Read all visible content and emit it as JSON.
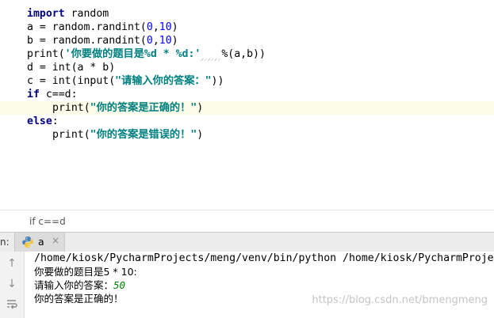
{
  "editor": {
    "lines": {
      "l1_kw": "import",
      "l1_rest": " random",
      "l2_a": "a = random.randint(",
      "l2_n1": "0",
      "l2_c": ",",
      "l2_n2": "10",
      "l2_e": ")",
      "l3_a": "b = random.randint(",
      "l3_n1": "0",
      "l3_c": ",",
      "l3_n2": "10",
      "l3_e": ")",
      "l4_a": "print(",
      "l4_str": "'你要做的题目是%d * %d:'",
      "l4_e": "%(a,b))",
      "l5": "d = int(a * b)",
      "l6_a": "c = int(input(",
      "l6_str": "\"请输入你的答案：\"",
      "l6_e": "))",
      "l7_kw": "if",
      "l7_rest": " c==d:",
      "l8_a": "print(",
      "l8_str": "\"你的答案是正确的！\"",
      "l8_e": ")",
      "l9_kw": "else",
      "l9_rest": ":",
      "l10_a": "print(",
      "l10_str": "\"你的答案是错误的！\"",
      "l10_e": ")"
    },
    "breadcrumb": "if c==d"
  },
  "run_panel": {
    "panel_label": "n:",
    "tab_label": "a",
    "tab_close": "×",
    "console": {
      "cmd": "/home/kiosk/PycharmProjects/meng/venv/bin/python /home/kiosk/PycharmProjects/meng/a.py",
      "question": "你要做的题目是5 * 10:",
      "prompt": "请输入你的答案：",
      "input_value": "50",
      "result": "你的答案是正确的！"
    }
  },
  "watermark": "https://blog.csdn.net/bmengmeng",
  "colors": {
    "keyword": "#000080",
    "number": "#0000ff",
    "string": "#008080",
    "input": "#008000",
    "current_line": "#fcfae9"
  }
}
